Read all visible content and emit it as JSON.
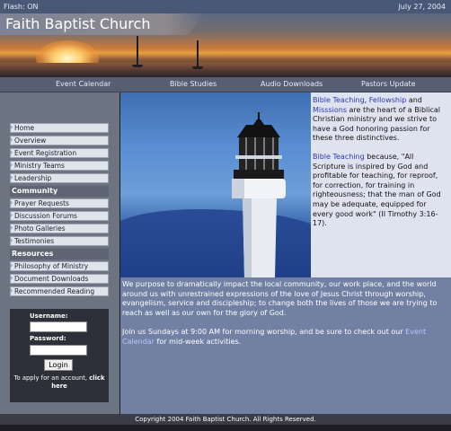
{
  "topbar": {
    "flash": "Flash: ON",
    "date": "July 27, 2004"
  },
  "banner": {
    "title": "Faith Baptist Church"
  },
  "nav": {
    "items": [
      "Event Calendar",
      "Bible Studies",
      "Audio Downloads",
      "Pastors Update"
    ]
  },
  "sidebar": {
    "main_items": [
      "Home",
      "Overview",
      "Event Registration",
      "Ministry Teams",
      "Leadership"
    ],
    "community_heading": "Community",
    "community_items": [
      "Prayer Requests",
      "Discussion Forums",
      "Photo Galleries",
      "Testimonies"
    ],
    "resources_heading": "Resources",
    "resources_items": [
      "Philosophy of Ministry",
      "Document Downloads",
      "Recommended Reading"
    ]
  },
  "login": {
    "username_label": "Username:",
    "password_label": "Password:",
    "button": "Login",
    "apply_text": "To apply for an account,",
    "apply_link": "click here"
  },
  "intro": {
    "link1": "Bible Teaching",
    "sep1": ", ",
    "link2": "Fellowship",
    "and": " and ",
    "link3": "Misssions",
    "text1": " are the heart of a Biblical Christian ministry and we strive to have a God honoring passion for these three distinctives.",
    "link4": "Bible Teaching",
    "text2": " because, \"All Scripture is inspired by God and profitable for teaching, for reproof, for correction, for training in righteousness; that the man of God may be adequate, equipped for every good work\" (II Timothy 3:16-17)."
  },
  "main": {
    "para1": "We purpose to dramatically impact the local community, our work place, and the world around us with unrestrained expressions of the love of Jesus Christ through worship, evangelism, service and discipleship; to change both the lives of those we are trying to reach as well as our own for the glory of God.",
    "para2_start": "Join us Sundays at 9:00 AM for morning worship, and be sure to check out our ",
    "para2_link": "Event Calendar",
    "para2_end": " for mid-week activities."
  },
  "footer": {
    "text": "Copyright 2004 Faith Baptist Church. All Rights Reserved."
  },
  "colors": {
    "accent_link": "#2a3ab0",
    "sidebar_bg": "#6c7482",
    "content_bg": "#7280a4"
  }
}
